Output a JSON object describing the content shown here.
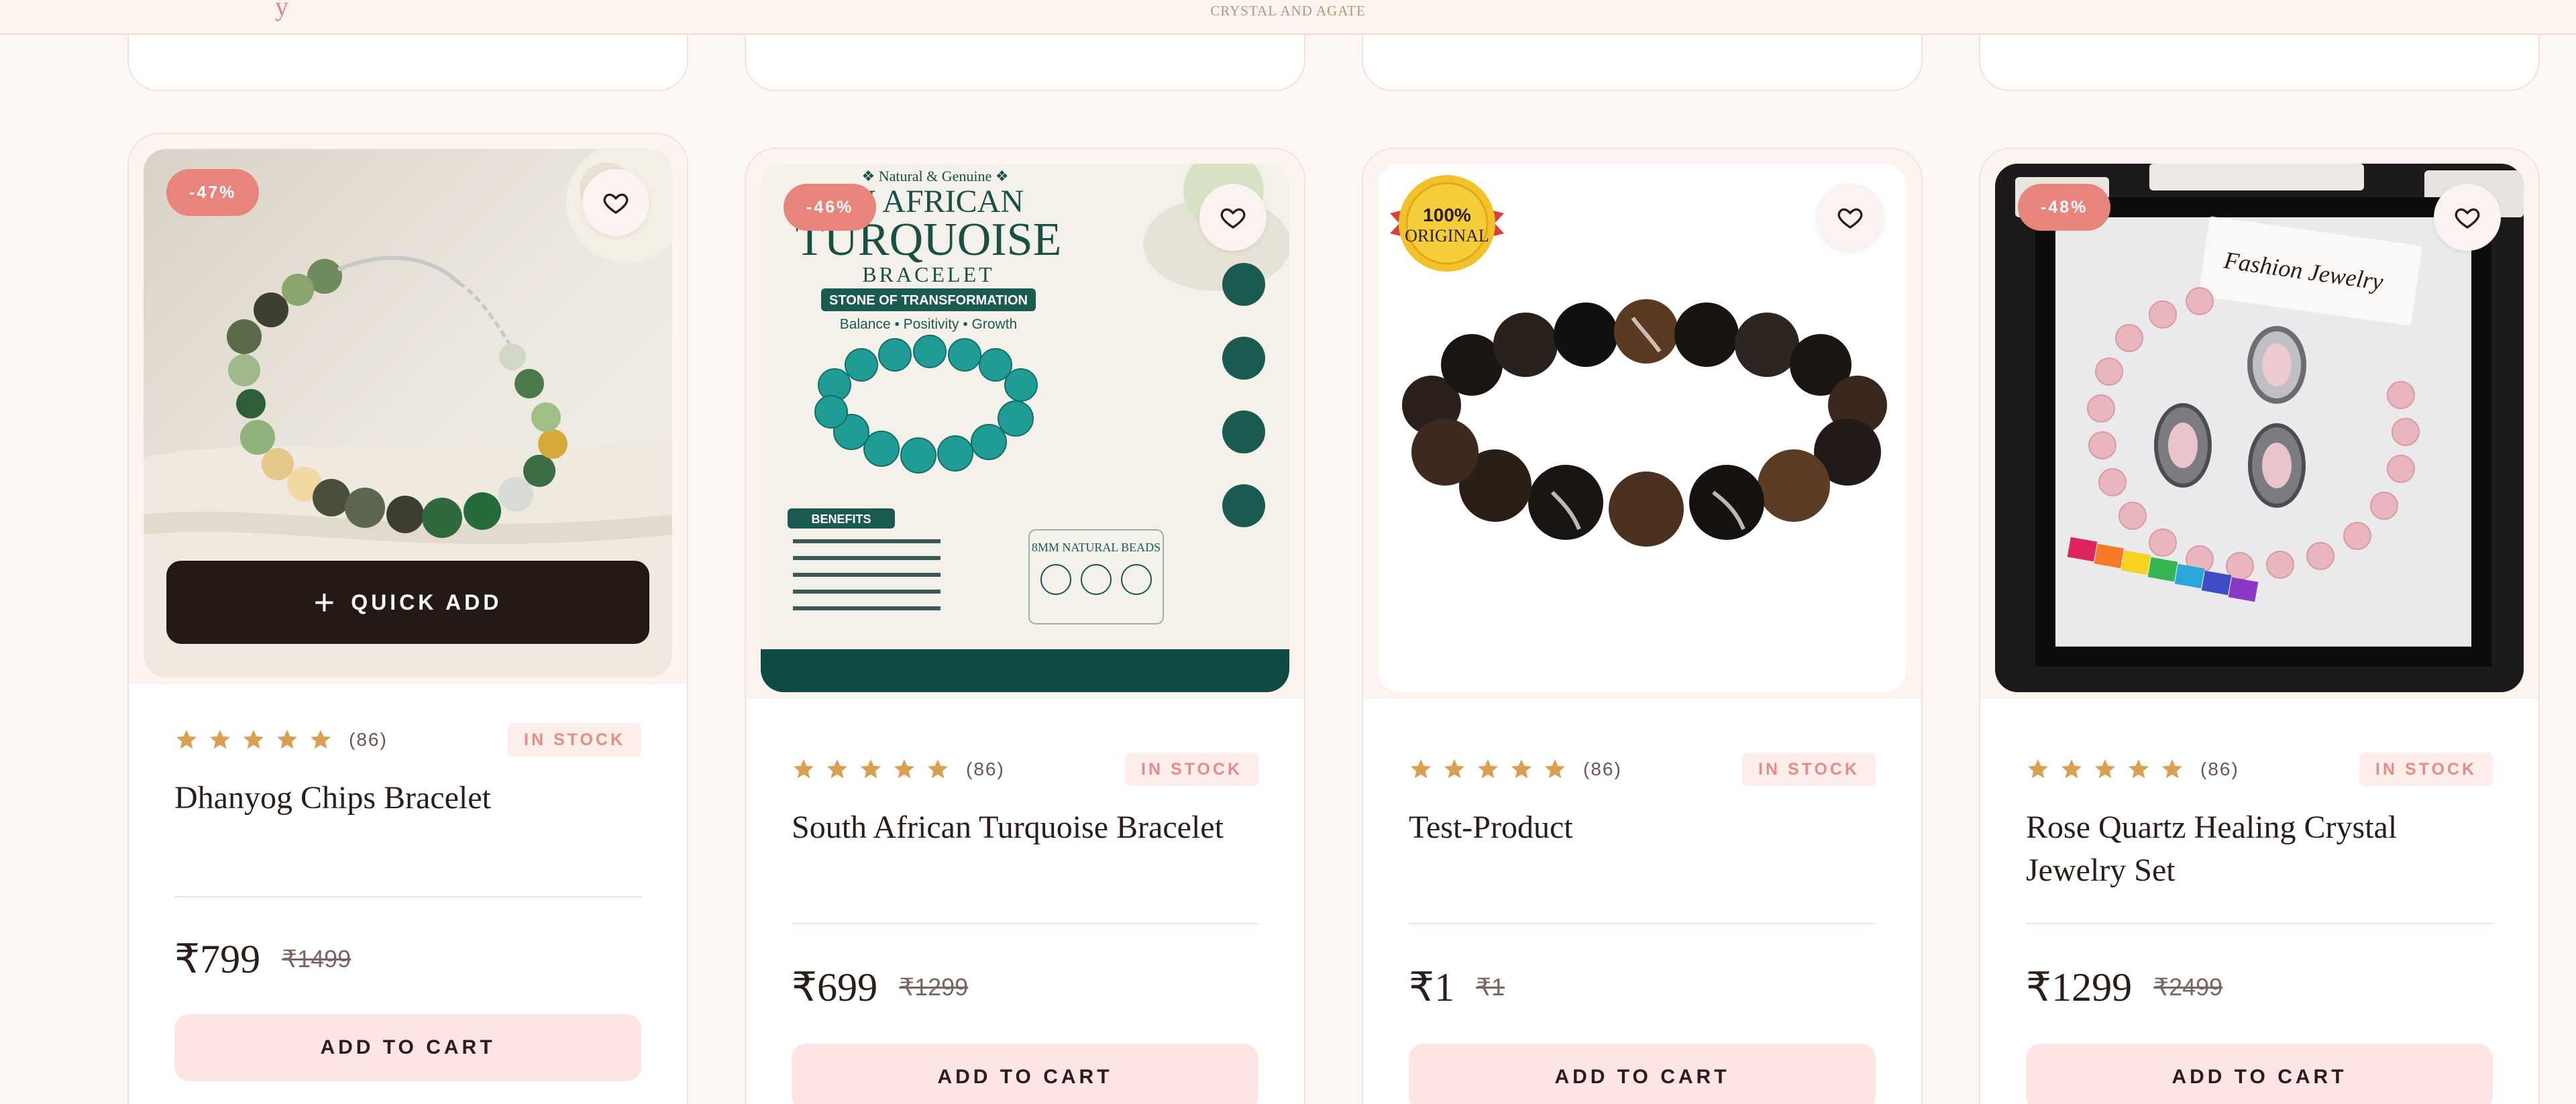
{
  "header": {
    "tagline": "CRYSTAL AND AGATE",
    "brand_fragment": "y"
  },
  "colors": {
    "accent": "#e7857c",
    "star": "#d9a052",
    "button_dark": "#251915",
    "cart_button": "#fde5e4",
    "background": "#fdf8f5"
  },
  "products": [
    {
      "discount": "-47%",
      "rating_stars": 5,
      "review_count": "(86)",
      "stock": "IN STOCK",
      "name": "Dhanyog Chips Bracelet",
      "price": "₹799",
      "compare_price": "₹1499",
      "cta": "ADD TO CART",
      "quick_add": "QUICK ADD",
      "icon": "heart-icon"
    },
    {
      "discount": "-46%",
      "rating_stars": 5,
      "review_count": "(86)",
      "stock": "IN STOCK",
      "name": "South African Turquoise Bracelet",
      "price": "₹699",
      "compare_price": "₹1299",
      "cta": "ADD TO CART",
      "icon": "heart-icon",
      "image_text": {
        "kicker": "❖ Natural & Genuine ❖",
        "line1": "TH AFRICAN",
        "line2": "TURQUOISE",
        "line3": "BRACELET",
        "ribbon": "STONE OF TRANSFORMATION",
        "tagline": "Balance • Positivity • Growth",
        "benefits_title": "BENEFITS",
        "beads": "8MM NATURAL BEADS"
      }
    },
    {
      "seal_line1": "100%",
      "seal_line2": "ORIGINAL",
      "rating_stars": 5,
      "review_count": "(86)",
      "stock": "IN STOCK",
      "name": "Test-Product",
      "price": "₹1",
      "compare_price": "₹1",
      "cta": "ADD TO CART",
      "icon": "heart-icon"
    },
    {
      "discount": "-48%",
      "rating_stars": 5,
      "review_count": "(86)",
      "stock": "IN STOCK",
      "name": "Rose Quartz Healing Crystal Jewelry Set",
      "price": "₹1299",
      "compare_price": "₹2499",
      "cta": "ADD TO CART",
      "icon": "heart-icon",
      "image_text": {
        "card_label": "Fashion Jewelry"
      }
    }
  ]
}
